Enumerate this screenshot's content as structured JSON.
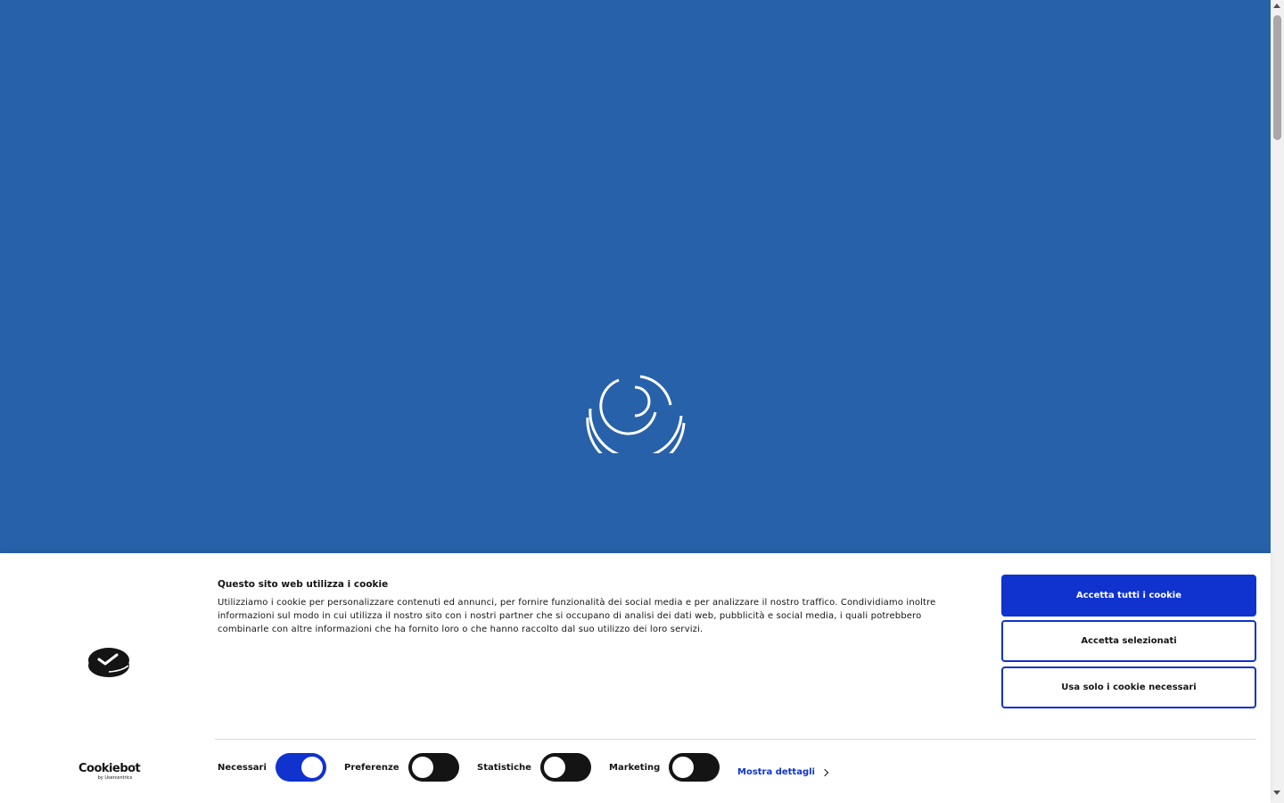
{
  "page": {
    "background_color": "#2761a9",
    "loading_indicator": "spinner-icon"
  },
  "cookie_banner": {
    "title": "Questo sito web utilizza i cookie",
    "text": "Utilizziamo i cookie per personalizzare contenuti ed annunci, per fornire funzionalità dei social media e per analizzare il nostro traffico. Condividiamo inoltre informazioni sul modo in cui utilizza il nostro sito con i nostri partner che si occupano di analisi dei dati web, pubblicità e social media, i quali potrebbero combinarle con altre informazioni che ha fornito loro o che hanno raccolto dal suo utilizzo dei loro servizi.",
    "buttons": {
      "accept_all": "Accetta tutti i cookie",
      "accept_selected": "Accetta selezionati",
      "necessary_only": "Usa solo i cookie necessari"
    },
    "toggles": [
      {
        "label": "Necessari",
        "on": true
      },
      {
        "label": "Preferenze",
        "on": false
      },
      {
        "label": "Statistiche",
        "on": false
      },
      {
        "label": "Marketing",
        "on": false
      }
    ],
    "details_link": "Mostra dettagli",
    "brand_logo": "cookie-check-logo",
    "provider_logo": {
      "name": "Cookiebot",
      "sub": "by Usercentrics"
    },
    "accent_color": "#1032cf"
  }
}
